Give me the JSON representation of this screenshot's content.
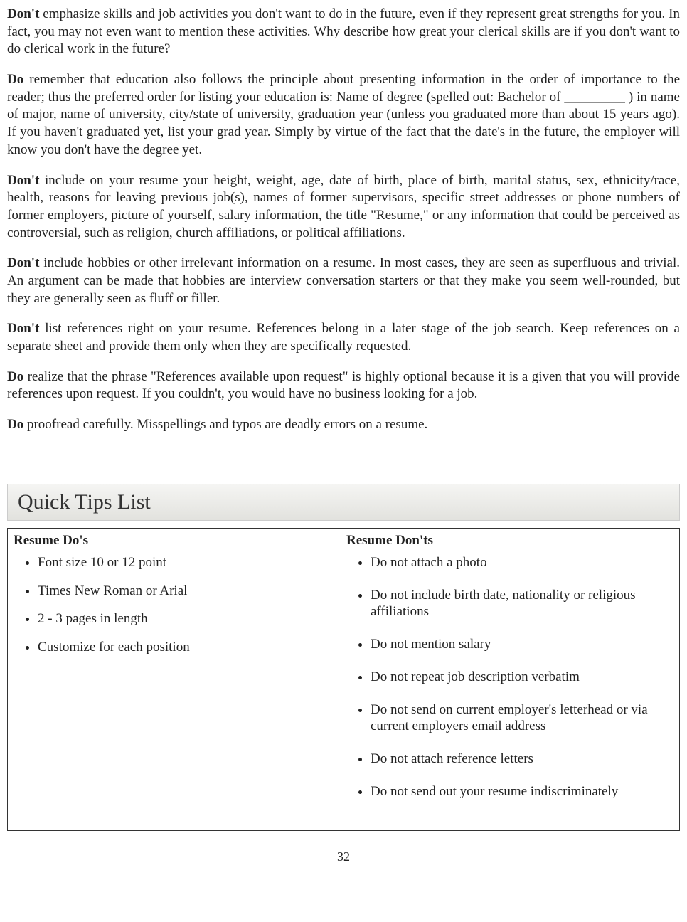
{
  "paragraphs": {
    "p1_bold": "Don't",
    "p1_rest": " emphasize skills and job activities you don't want to do in the future, even if they represent great strengths for you. In fact, you may not even want to mention these activities. Why describe how great your clerical skills are if you don't want to do clerical work in the future?",
    "p2_bold": "Do",
    "p2_rest": " remember that education also follows the principle about presenting information in the order of importance to the reader; thus the preferred order for listing your education is: Name of degree (spelled out: Bachelor of _________ ) in name of major, name of university, city/state of university, graduation year (unless you graduated more than about 15 years ago).  If you haven't graduated yet, list your grad year. Simply by virtue of the fact that the date's in the future, the employer will know you don't have the degree yet.",
    "p3_bold": "Don't",
    "p3_rest": " include on your resume your height, weight, age, date of birth, place of birth, marital status, sex, ethnicity/race, health, reasons for leaving previous job(s), names of former supervisors, specific street addresses or phone numbers of former employers, picture of yourself, salary information, the title \"Resume,\" or any information that could be perceived as controversial, such as religion, church affiliations, or political affiliations.",
    "p4_bold": "Don't",
    "p4_rest": " include hobbies or other irrelevant information on a resume. In most cases, they are seen as superfluous and trivial. An argument can be made that hobbies are interview conversation starters or that they make you seem well-rounded, but they are generally seen as fluff or filler.",
    "p5_bold": "Don't",
    "p5_rest": " list references right on your resume. References belong in a later stage of the job search. Keep references on a separate sheet and provide them only when they are specifically requested.",
    "p6_bold": "Do",
    "p6_rest": " realize that the phrase \"References available upon request\" is highly optional because it is a given that you will provide references upon request. If you couldn't, you would have no business looking for a job.",
    "p7_bold": "Do",
    "p7_rest": " proofread carefully. Misspellings and typos are deadly errors on a resume."
  },
  "section_header": "Quick Tips List",
  "tips": {
    "dos_heading": "Resume Do's",
    "donts_heading": "Resume Don'ts",
    "dos": [
      "Font size 10 or 12 point",
      "Times New Roman or Arial",
      "2 - 3 pages in length",
      "Customize for each position"
    ],
    "donts": [
      "Do not attach a photo",
      "Do not include birth date, nationality or religious affiliations",
      "Do not mention salary",
      "Do not repeat job description verbatim",
      "Do not send on current employer's letterhead or via current employers email address",
      "Do not attach reference letters",
      "Do not send out your resume indiscriminately"
    ]
  },
  "page_number": "32"
}
